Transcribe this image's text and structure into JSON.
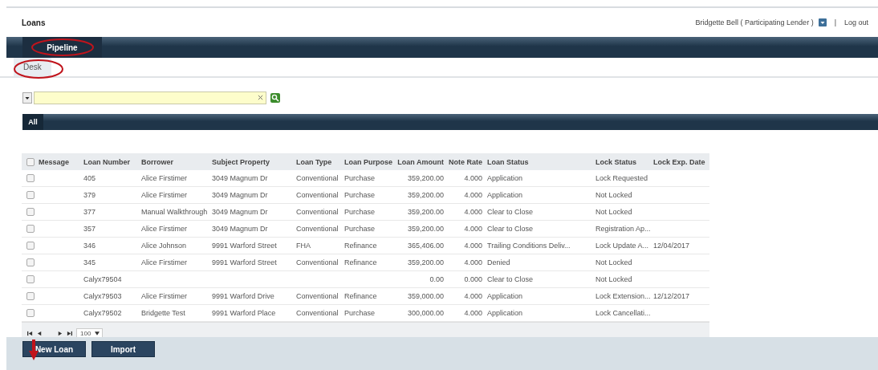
{
  "header": {
    "title": "Loans",
    "user": "Bridgette Bell ( Participating Lender )",
    "separator": "|",
    "logout": "Log out"
  },
  "nav_tabs": [
    {
      "label": "Pipeline",
      "selected": true
    }
  ],
  "sub_tabs": [
    {
      "label": "Desk",
      "selected": true
    }
  ],
  "view_tabs": [
    {
      "label": "All",
      "selected": true
    }
  ],
  "table": {
    "columns": [
      "Message",
      "Loan Number",
      "Borrower",
      "Subject Property",
      "Loan Type",
      "Loan Purpose",
      "Loan Amount",
      "Note Rate",
      "Loan Status",
      "Lock Status",
      "Lock Exp. Date"
    ],
    "header_checked": false,
    "rows": [
      {
        "checked": false,
        "cells": [
          "",
          "405",
          "Alice Firstimer",
          "3049 Magnum Dr",
          "Conventional",
          "Purchase",
          "359,200.00",
          "4.000",
          "Application",
          "Lock Requested",
          ""
        ]
      },
      {
        "checked": false,
        "cells": [
          "",
          "379",
          "Alice Firstimer",
          "3049 Magnum Dr",
          "Conventional",
          "Purchase",
          "359,200.00",
          "4.000",
          "Application",
          "Not Locked",
          ""
        ]
      },
      {
        "checked": false,
        "cells": [
          "",
          "377",
          "Manual Walkthrough",
          "3049 Magnum Dr",
          "Conventional",
          "Purchase",
          "359,200.00",
          "4.000",
          "Clear to Close",
          "Not Locked",
          ""
        ]
      },
      {
        "checked": false,
        "cells": [
          "",
          "357",
          "Alice Firstimer",
          "3049 Magnum Dr",
          "Conventional",
          "Purchase",
          "359,200.00",
          "4.000",
          "Clear to Close",
          "Registration Ap...",
          ""
        ]
      },
      {
        "checked": false,
        "cells": [
          "",
          "346",
          "Alice Johnson",
          "9991 Warford Street",
          "FHA",
          "Refinance",
          "365,406.00",
          "4.000",
          "Trailing Conditions Deliv...",
          "Lock Update A...",
          "12/04/2017"
        ]
      },
      {
        "checked": false,
        "cells": [
          "",
          "345",
          "Alice Firstimer",
          "9991 Warford Street",
          "Conventional",
          "Refinance",
          "359,200.00",
          "4.000",
          "Denied",
          "Not Locked",
          ""
        ]
      },
      {
        "checked": false,
        "cells": [
          "",
          "Calyx79504",
          "",
          "",
          "",
          "",
          "0.00",
          "0.000",
          "Clear to Close",
          "Not Locked",
          ""
        ]
      },
      {
        "checked": false,
        "cells": [
          "",
          "Calyx79503",
          "Alice Firstimer",
          "9991 Warford Drive",
          "Conventional",
          "Refinance",
          "359,000.00",
          "4.000",
          "Application",
          "Lock Extension...",
          "12/12/2017"
        ]
      },
      {
        "checked": false,
        "cells": [
          "",
          "Calyx79502",
          "Bridgette Test",
          "9991 Warford Place",
          "Conventional",
          "Purchase",
          "300,000.00",
          "4.000",
          "Application",
          "Lock Cancellati...",
          ""
        ]
      }
    ]
  },
  "pager": {
    "page_size": "100"
  },
  "buttons": [
    "New Loan",
    "Import"
  ]
}
